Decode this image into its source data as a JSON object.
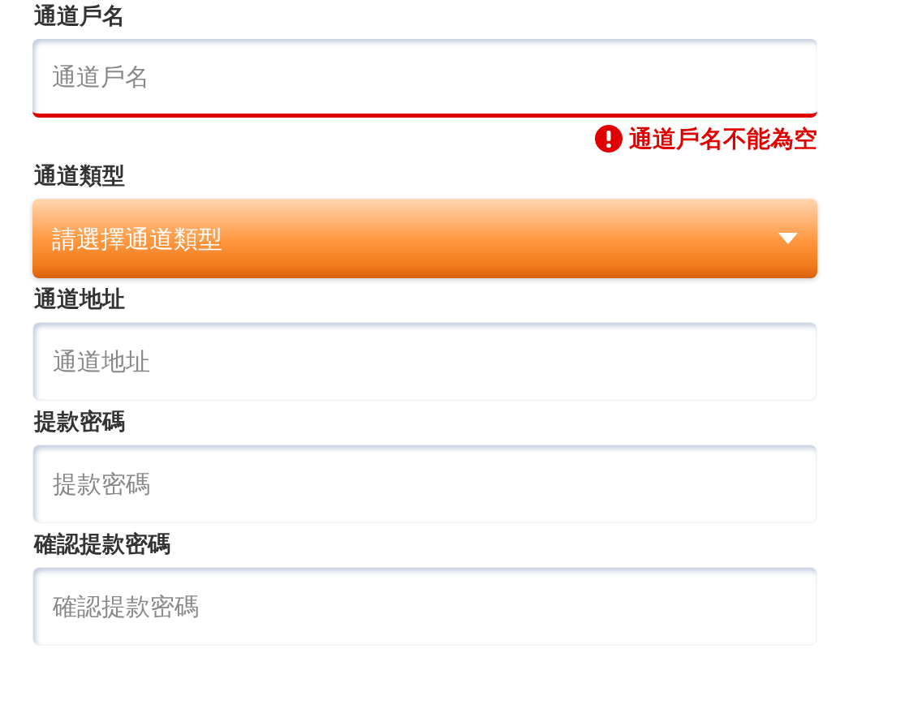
{
  "fields": [
    {
      "kind": "text",
      "label": "通道戶名",
      "placeholder": "通道戶名",
      "invalid": true,
      "error": "通道戶名不能為空"
    },
    {
      "kind": "select",
      "label": "通道類型",
      "placeholder": "請選擇通道類型"
    },
    {
      "kind": "text",
      "label": "通道地址",
      "placeholder": "通道地址",
      "invalid": false
    },
    {
      "kind": "text",
      "label": "提款密碼",
      "placeholder": "提款密碼",
      "invalid": false
    },
    {
      "kind": "text",
      "label": "確認提款密碼",
      "placeholder": "確認提款密碼",
      "invalid": false
    }
  ]
}
